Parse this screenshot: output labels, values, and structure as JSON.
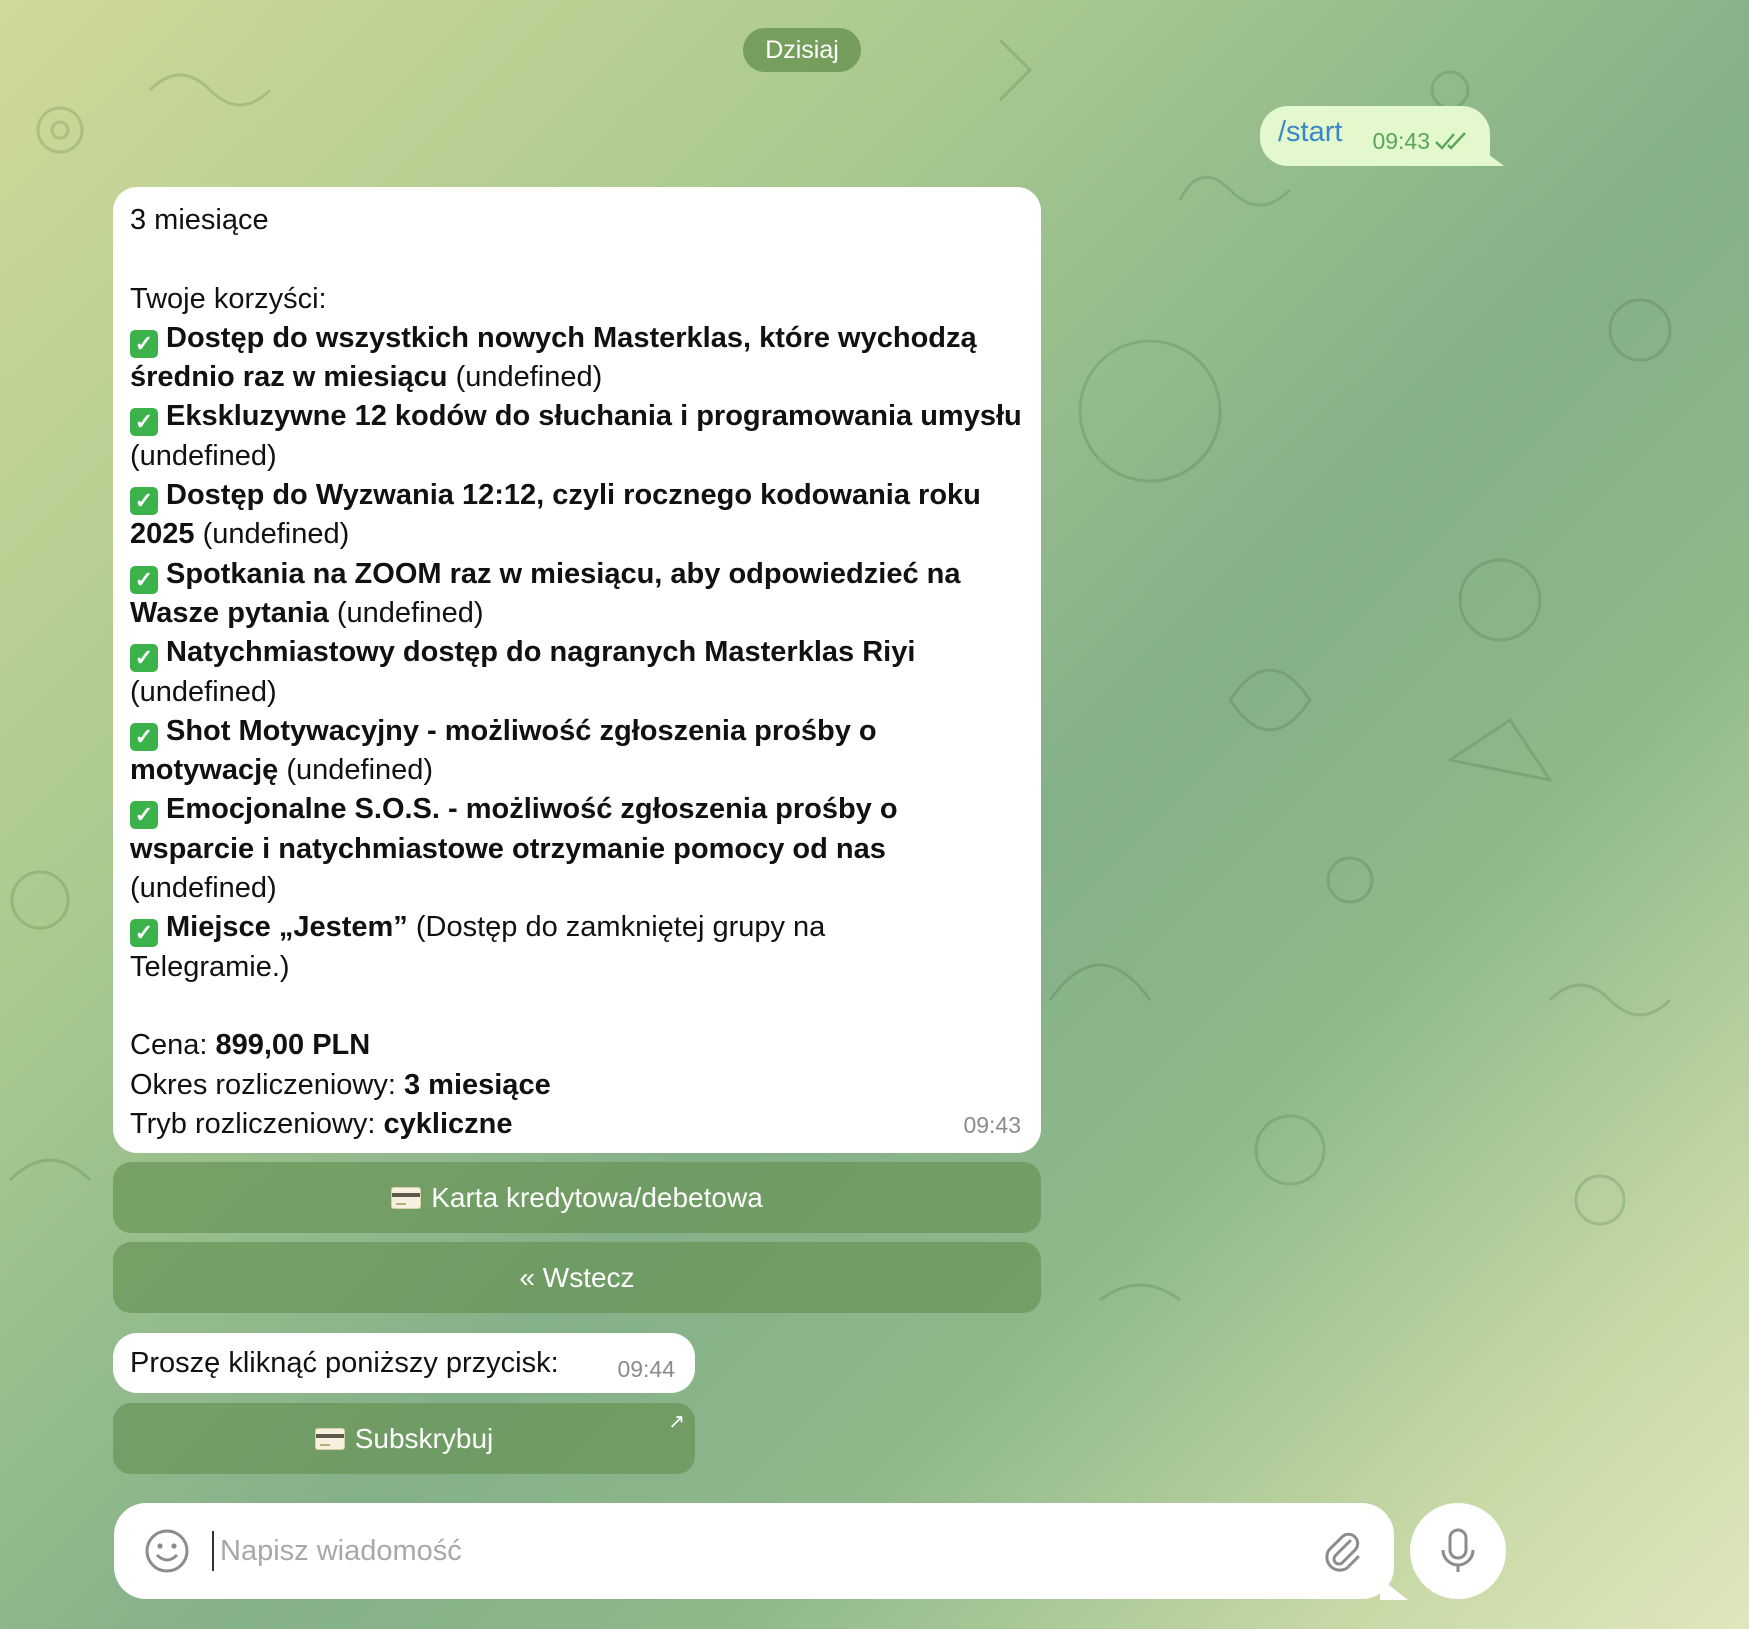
{
  "date_separator": "Dzisiaj",
  "outgoing": {
    "text": "/start",
    "time": "09:43",
    "status_icon": "double-check-icon"
  },
  "offer": {
    "title": "3 miesiące",
    "benefits_heading": "Twoje korzyści:",
    "benefits": [
      {
        "lines": [
          {
            "bold": "Dostęp do wszystkich nowych Masterklas, które wychodzą"
          },
          {
            "bold": "średnio raz w miesiącu",
            "rest": " (undefined)"
          }
        ]
      },
      {
        "lines": [
          {
            "bold": "Ekskluzywne 12 kodów do słuchania i programowania umysłu"
          },
          {
            "rest": "(undefined)"
          }
        ]
      },
      {
        "lines": [
          {
            "bold": "Dostęp do Wyzwania 12:12, czyli rocznego kodowania roku"
          },
          {
            "bold": "2025",
            "rest": " (undefined)"
          }
        ]
      },
      {
        "lines": [
          {
            "bold": "Spotkania na ZOOM raz w miesiącu, aby odpowiedzieć na"
          },
          {
            "bold": "Wasze pytania",
            "rest": " (undefined)"
          }
        ]
      },
      {
        "lines": [
          {
            "bold": "Natychmiastowy dostęp do nagranych Masterklas Riyi"
          },
          {
            "rest": "(undefined)"
          }
        ]
      },
      {
        "lines": [
          {
            "bold": "Shot Motywacyjny - możliwość zgłoszenia prośby o"
          },
          {
            "bold": "motywację",
            "rest": " (undefined)"
          }
        ]
      },
      {
        "lines": [
          {
            "bold": "Emocjonalne S.O.S. - możliwość zgłoszenia prośby o"
          },
          {
            "bold": "wsparcie i natychmiastowe otrzymanie pomocy od nas"
          },
          {
            "rest": "(undefined)"
          }
        ]
      },
      {
        "lines": [
          {
            "bold": "Miejsce „Jestem”",
            "rest": " (Dostęp do zamkniętej grupy na"
          },
          {
            "rest": "Telegramie.)"
          }
        ]
      }
    ],
    "price_label": "Cena: ",
    "price_value": "899,00 PLN",
    "period_label": "Okres rozliczeniowy: ",
    "period_value": "3 miesiące",
    "mode_label": "Tryb rozliczeniowy: ",
    "mode_value": "cykliczne",
    "time": "09:43"
  },
  "buttons": {
    "card": "Karta kredytowa/debetowa",
    "back": "« Wstecz",
    "subscribe": "Subskrybuj"
  },
  "prompt": {
    "text": "Proszę kliknąć poniższy przycisk:",
    "time": "09:44"
  },
  "composer": {
    "placeholder": "Napisz wiadomość"
  },
  "colors": {
    "outgoing_bubble": "#e3f8cc",
    "link": "#3a86c8",
    "check_green": "#3cb34a",
    "keyboard_button": "#628e4e"
  }
}
